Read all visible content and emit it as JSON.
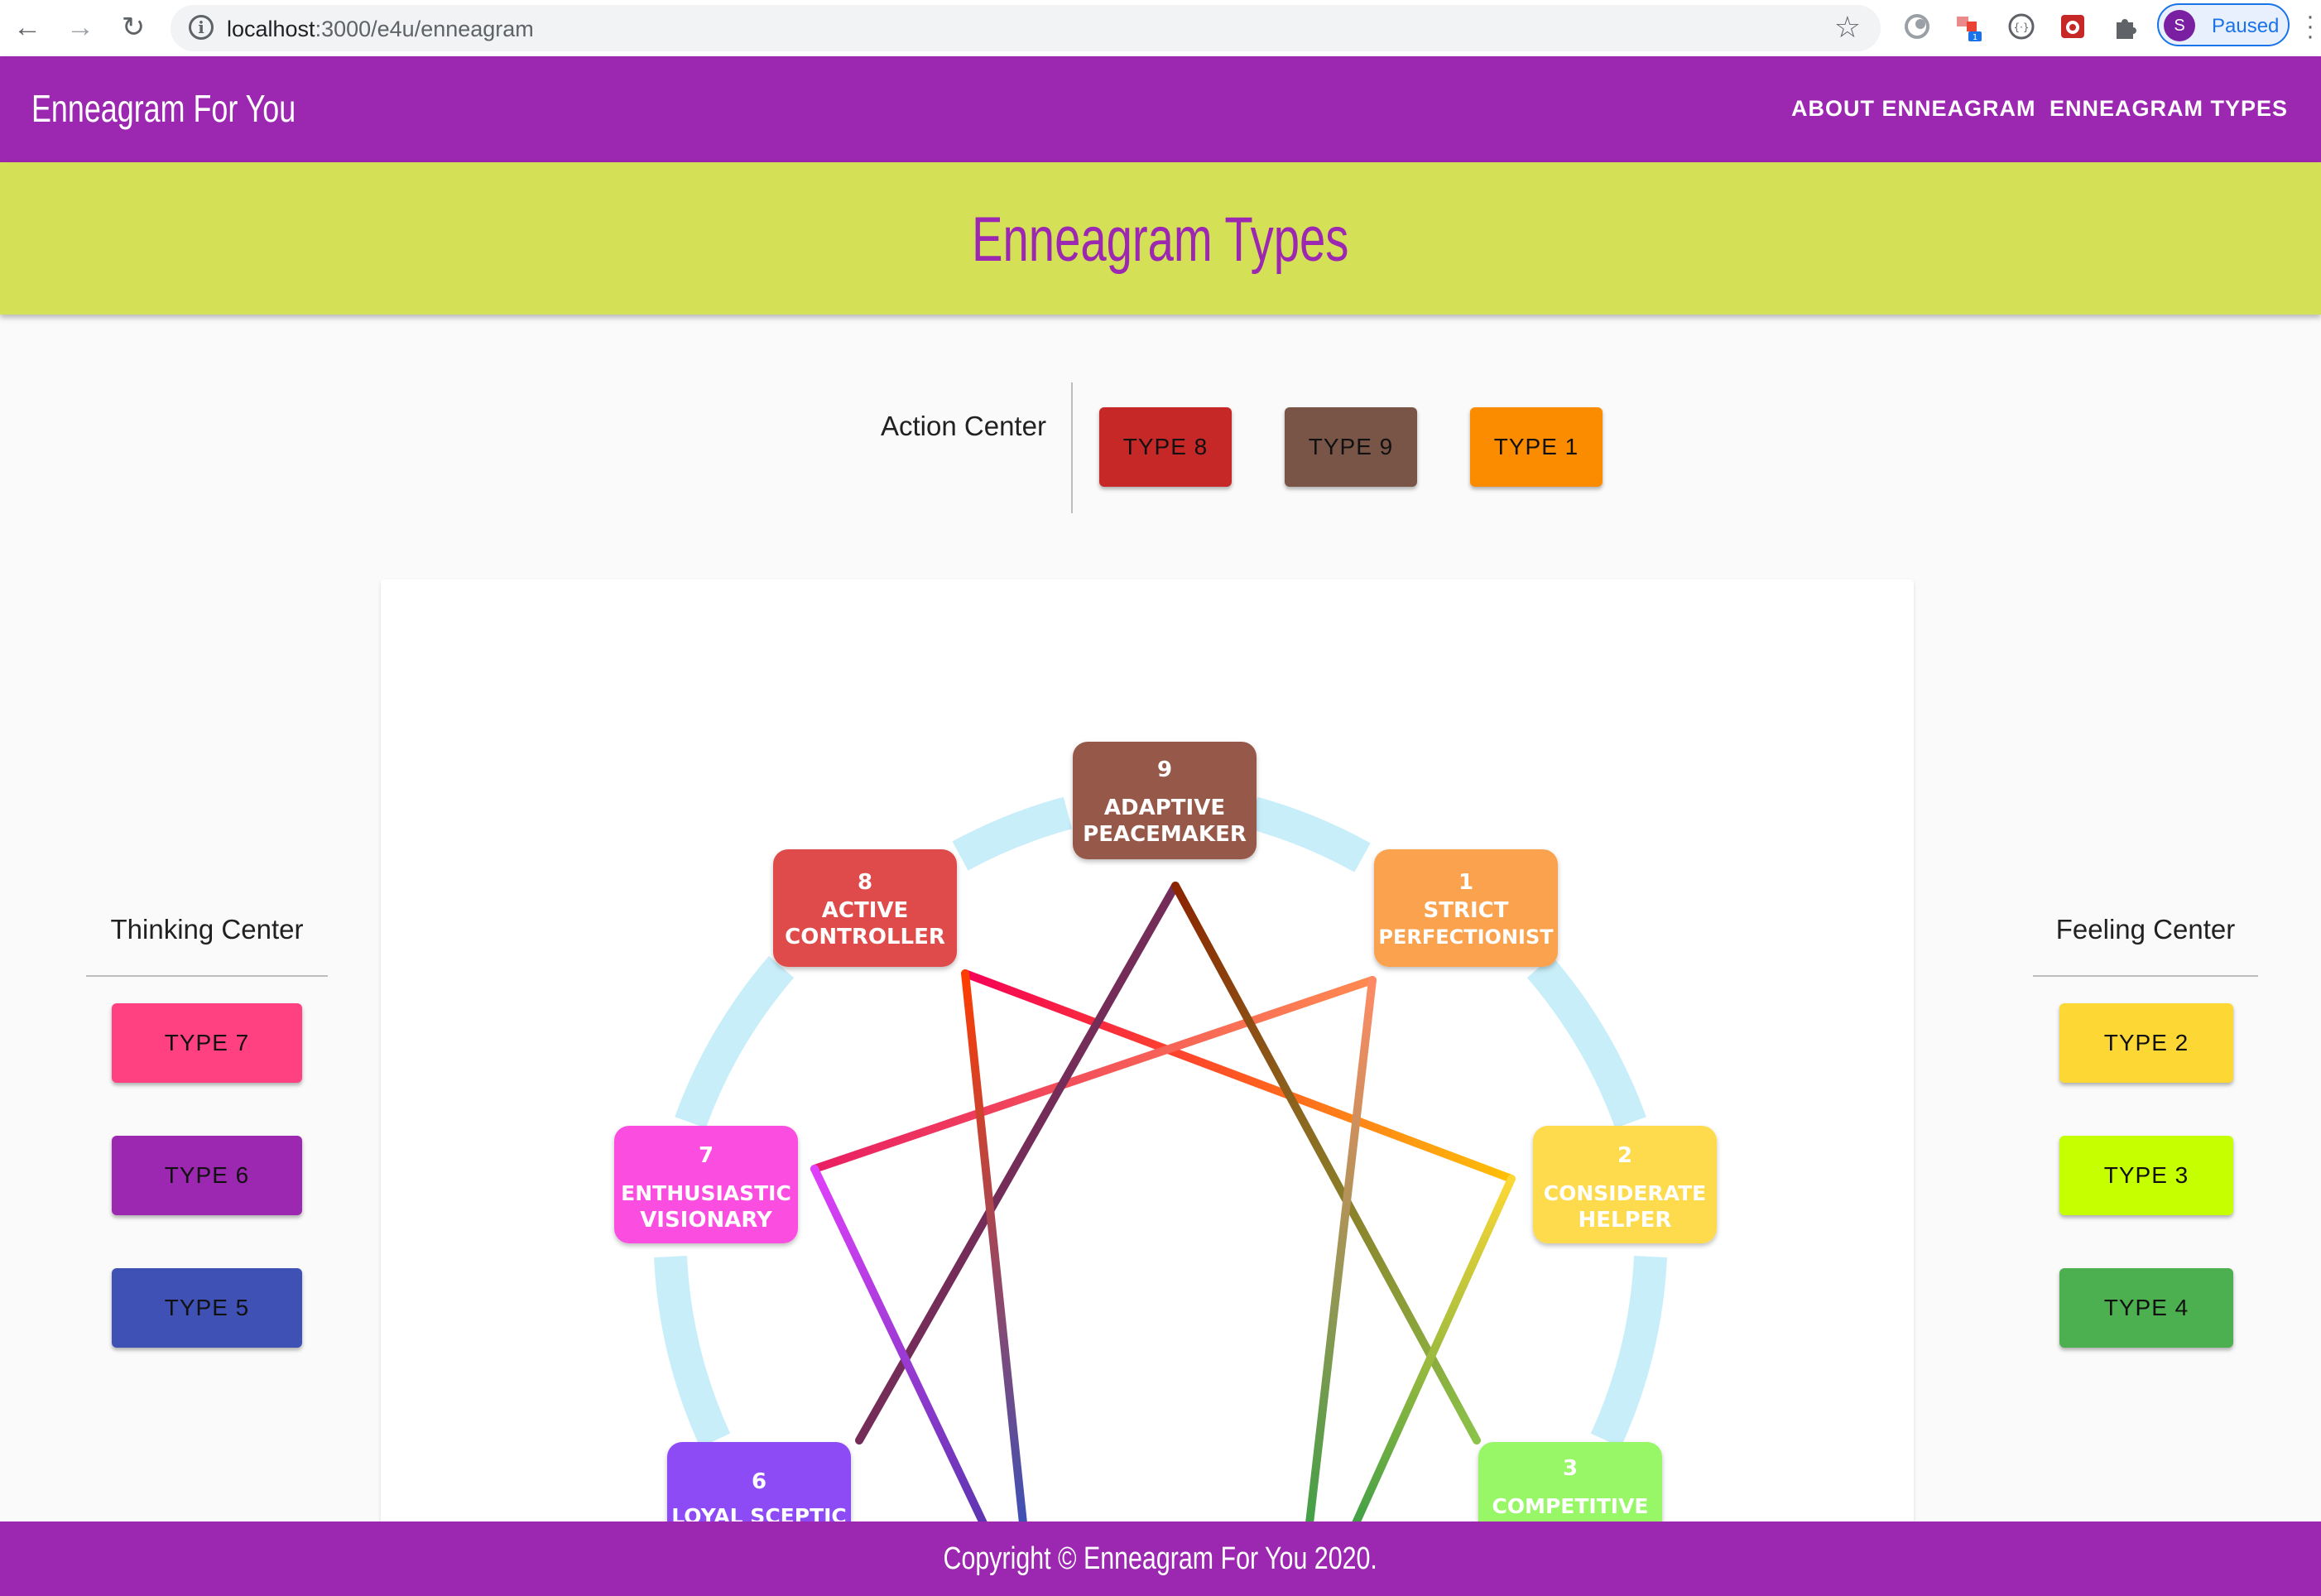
{
  "browser": {
    "url_host": "localhost",
    "url_path": ":3000/e4u/enneagram",
    "profile_initial": "S",
    "profile_status": "Paused",
    "extension_badge": "1"
  },
  "appbar": {
    "brand": "Enneagram For You",
    "nav": [
      "ABOUT ENNEAGRAM",
      "ENNEAGRAM TYPES"
    ]
  },
  "page": {
    "title": "Enneagram Types"
  },
  "action_center": {
    "label": "Action Center",
    "types": [
      {
        "label": "TYPE 8",
        "color": "#c62828"
      },
      {
        "label": "TYPE 9",
        "color": "#795548"
      },
      {
        "label": "TYPE 1",
        "color": "#fb8c00"
      }
    ]
  },
  "thinking_center": {
    "label": "Thinking Center",
    "types": [
      {
        "label": "TYPE 7",
        "color": "#ff4081"
      },
      {
        "label": "TYPE 6",
        "color": "#9c27b0"
      },
      {
        "label": "TYPE 5",
        "color": "#3f51b5"
      }
    ]
  },
  "feeling_center": {
    "label": "Feeling Center",
    "types": [
      {
        "label": "TYPE 2",
        "color": "#fdd835"
      },
      {
        "label": "TYPE 3",
        "color": "#c6ff00"
      },
      {
        "label": "TYPE 4",
        "color": "#4caf50"
      }
    ]
  },
  "diagram": {
    "nodes": [
      {
        "num": "9",
        "line1": "ADAPTIVE",
        "line2": "PEACEMAKER",
        "color": "#96594a"
      },
      {
        "num": "1",
        "line1": "STRICT",
        "line2": "PERFECTIONIST",
        "color": "#fba24f"
      },
      {
        "num": "2",
        "line1": "CONSIDERATE",
        "line2": "HELPER",
        "color": "#fedb4d"
      },
      {
        "num": "3",
        "line1": "COMPETITIVE",
        "line2": "",
        "color": "#97f766"
      },
      {
        "num": "6",
        "line1": "LOYAL SCEPTIC",
        "line2": "",
        "color": "#8c4cf5"
      },
      {
        "num": "7",
        "line1": "ENTHUSIASTIC",
        "line2": "VISIONARY",
        "color": "#fb4ee0"
      },
      {
        "num": "8",
        "line1": "ACTIVE",
        "line2": "CONTROLLER",
        "color": "#df4b4b"
      }
    ],
    "circle_color": "#c8eefa"
  },
  "footer": {
    "text": "Copyright © Enneagram For You 2020."
  }
}
